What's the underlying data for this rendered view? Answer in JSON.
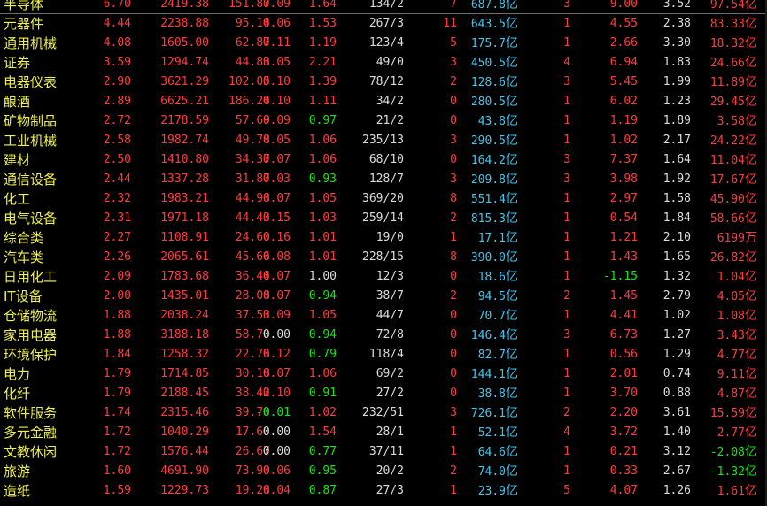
{
  "colors": {
    "background": "#000000",
    "up": "#ff3c3c",
    "down": "#14e614",
    "flat": "#dcdcdc",
    "name": "#f0f04a",
    "volume": "#3cc8f0"
  },
  "rows": [
    {
      "name": "半导体",
      "c1": "6.70",
      "c2": "2419.38",
      "c3": "151.87",
      "c4": "0.09",
      "c5": "1.64",
      "c6": "134/2",
      "c7": "7",
      "c8": "687.8",
      "c8unit": "亿",
      "c9": "3",
      "c10": "9.00",
      "c11": "3.52",
      "c12": "97.54",
      "c12unit": "亿",
      "c5sign": "up",
      "c10sign": "up",
      "c12sign": "up",
      "c4sign": "up"
    },
    {
      "name": "元器件",
      "c1": "4.44",
      "c2": "2238.88",
      "c3": "95.14",
      "c4": "0.06",
      "c5": "1.53",
      "c6": "267/3",
      "c7": "11",
      "c8": "643.5",
      "c8unit": "亿",
      "c9": "1",
      "c10": "4.55",
      "c11": "2.38",
      "c12": "83.33",
      "c12unit": "亿",
      "c5sign": "up",
      "c10sign": "up",
      "c12sign": "up",
      "c4sign": "up"
    },
    {
      "name": "通用机械",
      "c1": "4.08",
      "c2": "1605.00",
      "c3": "62.87",
      "c4": "0.11",
      "c5": "1.19",
      "c6": "123/4",
      "c7": "5",
      "c8": "175.7",
      "c8unit": "亿",
      "c9": "1",
      "c10": "2.66",
      "c11": "3.30",
      "c12": "18.32",
      "c12unit": "亿",
      "c5sign": "up",
      "c10sign": "up",
      "c12sign": "up",
      "c4sign": "up"
    },
    {
      "name": "证券",
      "c1": "3.59",
      "c2": "1294.74",
      "c3": "44.83",
      "c4": "0.05",
      "c5": "2.21",
      "c6": "49/0",
      "c7": "3",
      "c8": "450.5",
      "c8unit": "亿",
      "c9": "4",
      "c10": "6.94",
      "c11": "1.83",
      "c12": "24.66",
      "c12unit": "亿",
      "c5sign": "up",
      "c10sign": "up",
      "c12sign": "up",
      "c4sign": "up"
    },
    {
      "name": "电器仪表",
      "c1": "2.90",
      "c2": "3621.29",
      "c3": "102.05",
      "c4": "0.10",
      "c5": "1.39",
      "c6": "78/12",
      "c7": "2",
      "c8": "128.6",
      "c8unit": "亿",
      "c9": "3",
      "c10": "5.45",
      "c11": "1.99",
      "c12": "11.89",
      "c12unit": "亿",
      "c5sign": "up",
      "c10sign": "up",
      "c12sign": "up",
      "c4sign": "up"
    },
    {
      "name": "酿酒",
      "c1": "2.89",
      "c2": "6625.21",
      "c3": "186.24",
      "c4": "0.10",
      "c5": "1.11",
      "c6": "34/2",
      "c7": "0",
      "c8": "280.5",
      "c8unit": "亿",
      "c9": "1",
      "c10": "6.02",
      "c11": "1.23",
      "c12": "29.45",
      "c12unit": "亿",
      "c5sign": "up",
      "c10sign": "up",
      "c12sign": "up",
      "c4sign": "up"
    },
    {
      "name": "矿物制品",
      "c1": "2.72",
      "c2": "2178.59",
      "c3": "57.69",
      "c4": "0.09",
      "c5": "0.97",
      "c6": "21/2",
      "c7": "0",
      "c8": "43.8",
      "c8unit": "亿",
      "c9": "1",
      "c10": "1.19",
      "c11": "1.89",
      "c12": "3.58",
      "c12unit": "亿",
      "c5sign": "down",
      "c10sign": "up",
      "c12sign": "up",
      "c4sign": "up"
    },
    {
      "name": "工业机械",
      "c1": "2.58",
      "c2": "1982.74",
      "c3": "49.78",
      "c4": "0.05",
      "c5": "1.06",
      "c6": "235/13",
      "c7": "3",
      "c8": "290.5",
      "c8unit": "亿",
      "c9": "1",
      "c10": "1.02",
      "c11": "2.17",
      "c12": "24.22",
      "c12unit": "亿",
      "c5sign": "up",
      "c10sign": "up",
      "c12sign": "up",
      "c4sign": "up"
    },
    {
      "name": "建材",
      "c1": "2.50",
      "c2": "1410.80",
      "c3": "34.37",
      "c4": "0.07",
      "c5": "1.06",
      "c6": "68/10",
      "c7": "0",
      "c8": "164.2",
      "c8unit": "亿",
      "c9": "3",
      "c10": "7.37",
      "c11": "1.64",
      "c12": "11.04",
      "c12unit": "亿",
      "c5sign": "up",
      "c10sign": "up",
      "c12sign": "up",
      "c4sign": "up"
    },
    {
      "name": "通信设备",
      "c1": "2.44",
      "c2": "1337.28",
      "c3": "31.87",
      "c4": "0.03",
      "c5": "0.93",
      "c6": "128/7",
      "c7": "3",
      "c8": "209.8",
      "c8unit": "亿",
      "c9": "3",
      "c10": "3.98",
      "c11": "1.92",
      "c12": "17.67",
      "c12unit": "亿",
      "c5sign": "down",
      "c10sign": "up",
      "c12sign": "up",
      "c4sign": "up"
    },
    {
      "name": "化工",
      "c1": "2.32",
      "c2": "1983.21",
      "c3": "44.98",
      "c4": "0.07",
      "c5": "1.05",
      "c6": "369/20",
      "c7": "8",
      "c8": "551.4",
      "c8unit": "亿",
      "c9": "1",
      "c10": "2.97",
      "c11": "1.58",
      "c12": "45.90",
      "c12unit": "亿",
      "c5sign": "up",
      "c10sign": "up",
      "c12sign": "up",
      "c4sign": "up"
    },
    {
      "name": "电气设备",
      "c1": "2.31",
      "c2": "1971.18",
      "c3": "44.43",
      "c4": "0.15",
      "c5": "1.03",
      "c6": "259/14",
      "c7": "2",
      "c8": "815.3",
      "c8unit": "亿",
      "c9": "1",
      "c10": "0.54",
      "c11": "1.84",
      "c12": "58.66",
      "c12unit": "亿",
      "c5sign": "up",
      "c10sign": "up",
      "c12sign": "up",
      "c4sign": "up"
    },
    {
      "name": "综合类",
      "c1": "2.27",
      "c2": "1108.91",
      "c3": "24.60",
      "c4": "0.16",
      "c5": "1.01",
      "c6": "19/0",
      "c7": "1",
      "c8": "17.1",
      "c8unit": "亿",
      "c9": "1",
      "c10": "1.21",
      "c11": "2.10",
      "c12": "6199",
      "c12unit": "万",
      "c5sign": "up",
      "c10sign": "up",
      "c12sign": "up",
      "c4sign": "up"
    },
    {
      "name": "汽车类",
      "c1": "2.26",
      "c2": "2065.61",
      "c3": "45.66",
      "c4": "0.08",
      "c5": "1.01",
      "c6": "228/15",
      "c7": "8",
      "c8": "390.0",
      "c8unit": "亿",
      "c9": "1",
      "c10": "1.43",
      "c11": "1.65",
      "c12": "26.82",
      "c12unit": "亿",
      "c5sign": "up",
      "c10sign": "up",
      "c12sign": "up",
      "c4sign": "up"
    },
    {
      "name": "日用化工",
      "c1": "2.09",
      "c2": "1783.68",
      "c3": "36.44",
      "c4": "0.07",
      "c5": "1.00",
      "c6": "12/3",
      "c7": "0",
      "c8": "18.6",
      "c8unit": "亿",
      "c9": "1",
      "c10": "-1.15",
      "c11": "1.32",
      "c12": "1.04",
      "c12unit": "亿",
      "c5sign": "flat",
      "c10sign": "down",
      "c12sign": "up",
      "c4sign": "up"
    },
    {
      "name": "IT设备",
      "c1": "2.00",
      "c2": "1435.01",
      "c3": "28.08",
      "c4": "0.07",
      "c5": "0.94",
      "c6": "38/7",
      "c7": "2",
      "c8": "94.5",
      "c8unit": "亿",
      "c9": "2",
      "c10": "1.45",
      "c11": "2.79",
      "c12": "4.05",
      "c12unit": "亿",
      "c5sign": "down",
      "c10sign": "up",
      "c12sign": "up",
      "c4sign": "up"
    },
    {
      "name": "仓储物流",
      "c1": "1.88",
      "c2": "2038.24",
      "c3": "37.53",
      "c4": "0.09",
      "c5": "1.05",
      "c6": "44/7",
      "c7": "0",
      "c8": "70.7",
      "c8unit": "亿",
      "c9": "1",
      "c10": "4.41",
      "c11": "1.02",
      "c12": "1.08",
      "c12unit": "亿",
      "c5sign": "up",
      "c10sign": "up",
      "c12sign": "up",
      "c4sign": "up"
    },
    {
      "name": "家用电器",
      "c1": "1.88",
      "c2": "3188.18",
      "c3": "58.70",
      "c4": "0.00",
      "c5": "0.94",
      "c6": "72/8",
      "c7": "0",
      "c8": "146.4",
      "c8unit": "亿",
      "c9": "3",
      "c10": "6.73",
      "c11": "1.27",
      "c12": "3.43",
      "c12unit": "亿",
      "c5sign": "down",
      "c10sign": "up",
      "c12sign": "up",
      "c4sign": "flat"
    },
    {
      "name": "环境保护",
      "c1": "1.84",
      "c2": "1258.32",
      "c3": "22.76",
      "c4": "0.12",
      "c5": "0.79",
      "c6": "118/4",
      "c7": "0",
      "c8": "82.7",
      "c8unit": "亿",
      "c9": "1",
      "c10": "0.56",
      "c11": "1.29",
      "c12": "4.77",
      "c12unit": "亿",
      "c5sign": "down",
      "c10sign": "up",
      "c12sign": "up",
      "c4sign": "up"
    },
    {
      "name": "电力",
      "c1": "1.79",
      "c2": "1714.85",
      "c3": "30.18",
      "c4": "0.07",
      "c5": "1.06",
      "c6": "69/2",
      "c7": "0",
      "c8": "144.1",
      "c8unit": "亿",
      "c9": "1",
      "c10": "2.01",
      "c11": "0.74",
      "c12": "9.11",
      "c12unit": "亿",
      "c5sign": "up",
      "c10sign": "up",
      "c12sign": "up",
      "c4sign": "up"
    },
    {
      "name": "化纤",
      "c1": "1.79",
      "c2": "2188.45",
      "c3": "38.42",
      "c4": "0.10",
      "c5": "0.91",
      "c6": "27/2",
      "c7": "0",
      "c8": "38.8",
      "c8unit": "亿",
      "c9": "1",
      "c10": "3.70",
      "c11": "0.88",
      "c12": "4.87",
      "c12unit": "亿",
      "c5sign": "down",
      "c10sign": "up",
      "c12sign": "up",
      "c4sign": "up"
    },
    {
      "name": "软件服务",
      "c1": "1.74",
      "c2": "2315.46",
      "c3": "39.70",
      "c4": "-0.01",
      "c5": "1.02",
      "c6": "232/51",
      "c7": "3",
      "c8": "726.1",
      "c8unit": "亿",
      "c9": "2",
      "c10": "2.20",
      "c11": "3.61",
      "c12": "15.59",
      "c12unit": "亿",
      "c5sign": "up",
      "c10sign": "up",
      "c12sign": "up",
      "c4sign": "down"
    },
    {
      "name": "多元金融",
      "c1": "1.72",
      "c2": "1040.29",
      "c3": "17.60",
      "c4": "0.00",
      "c5": "1.54",
      "c6": "28/1",
      "c7": "1",
      "c8": "52.1",
      "c8unit": "亿",
      "c9": "4",
      "c10": "3.72",
      "c11": "1.40",
      "c12": "2.77",
      "c12unit": "亿",
      "c5sign": "up",
      "c10sign": "up",
      "c12sign": "up",
      "c4sign": "flat"
    },
    {
      "name": "文教休闲",
      "c1": "1.72",
      "c2": "1576.44",
      "c3": "26.67",
      "c4": "0.00",
      "c5": "0.77",
      "c6": "37/11",
      "c7": "1",
      "c8": "64.6",
      "c8unit": "亿",
      "c9": "1",
      "c10": "0.21",
      "c11": "3.12",
      "c12": "-2.08",
      "c12unit": "亿",
      "c5sign": "down",
      "c10sign": "up",
      "c12sign": "down",
      "c4sign": "flat"
    },
    {
      "name": "旅游",
      "c1": "1.60",
      "c2": "4691.90",
      "c3": "73.90",
      "c4": "0.06",
      "c5": "0.95",
      "c6": "20/2",
      "c7": "2",
      "c8": "74.0",
      "c8unit": "亿",
      "c9": "1",
      "c10": "0.33",
      "c11": "2.67",
      "c12": "-1.32",
      "c12unit": "亿",
      "c5sign": "down",
      "c10sign": "up",
      "c12sign": "down",
      "c4sign": "up"
    },
    {
      "name": "造纸",
      "c1": "1.59",
      "c2": "1229.73",
      "c3": "19.28",
      "c4": "0.04",
      "c5": "0.87",
      "c6": "27/3",
      "c7": "1",
      "c8": "23.9",
      "c8unit": "亿",
      "c9": "5",
      "c10": "4.07",
      "c11": "1.26",
      "c12": "1.61",
      "c12unit": "亿",
      "c5sign": "down",
      "c10sign": "up",
      "c12sign": "up",
      "c4sign": "up"
    }
  ]
}
